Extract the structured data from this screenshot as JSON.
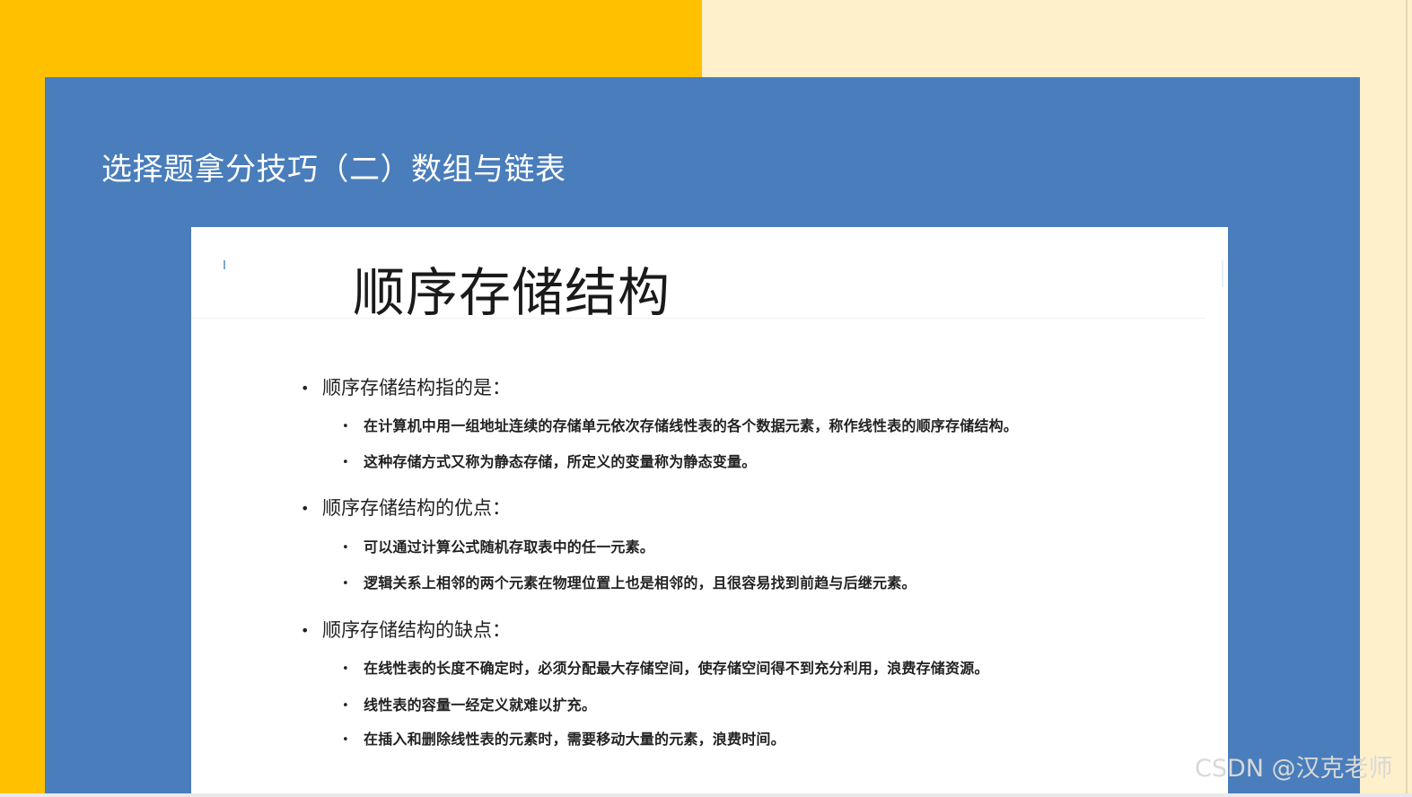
{
  "colors": {
    "left_background": "#FFC000",
    "right_background": "#FFF0CC",
    "panel": "#497DBB",
    "card": "#FFFFFF"
  },
  "slide": {
    "title": "选择题拿分技巧（二）数组与链表"
  },
  "card": {
    "heading": "顺序存储结构",
    "sections": [
      {
        "label": "顺序存储结构指的是：",
        "items": [
          "在计算机中用一组地址连续的存储单元依次存储线性表的各个数据元素，称作线性表的顺序存储结构。",
          "这种存储方式又称为静态存储，所定义的变量称为静态变量。"
        ]
      },
      {
        "label": "顺序存储结构的优点：",
        "items": [
          "可以通过计算公式随机存取表中的任一元素。",
          "逻辑关系上相邻的两个元素在物理位置上也是相邻的，且很容易找到前趋与后继元素。"
        ]
      },
      {
        "label": "顺序存储结构的缺点：",
        "items": [
          "在线性表的长度不确定时，必须分配最大存储空间，使存储空间得不到充分利用，浪费存储资源。",
          "线性表的容量一经定义就难以扩充。",
          "在插入和删除线性表的元素时，需要移动大量的元素，浪费时间。"
        ]
      }
    ]
  },
  "watermark": "CSDN @汉克老师"
}
